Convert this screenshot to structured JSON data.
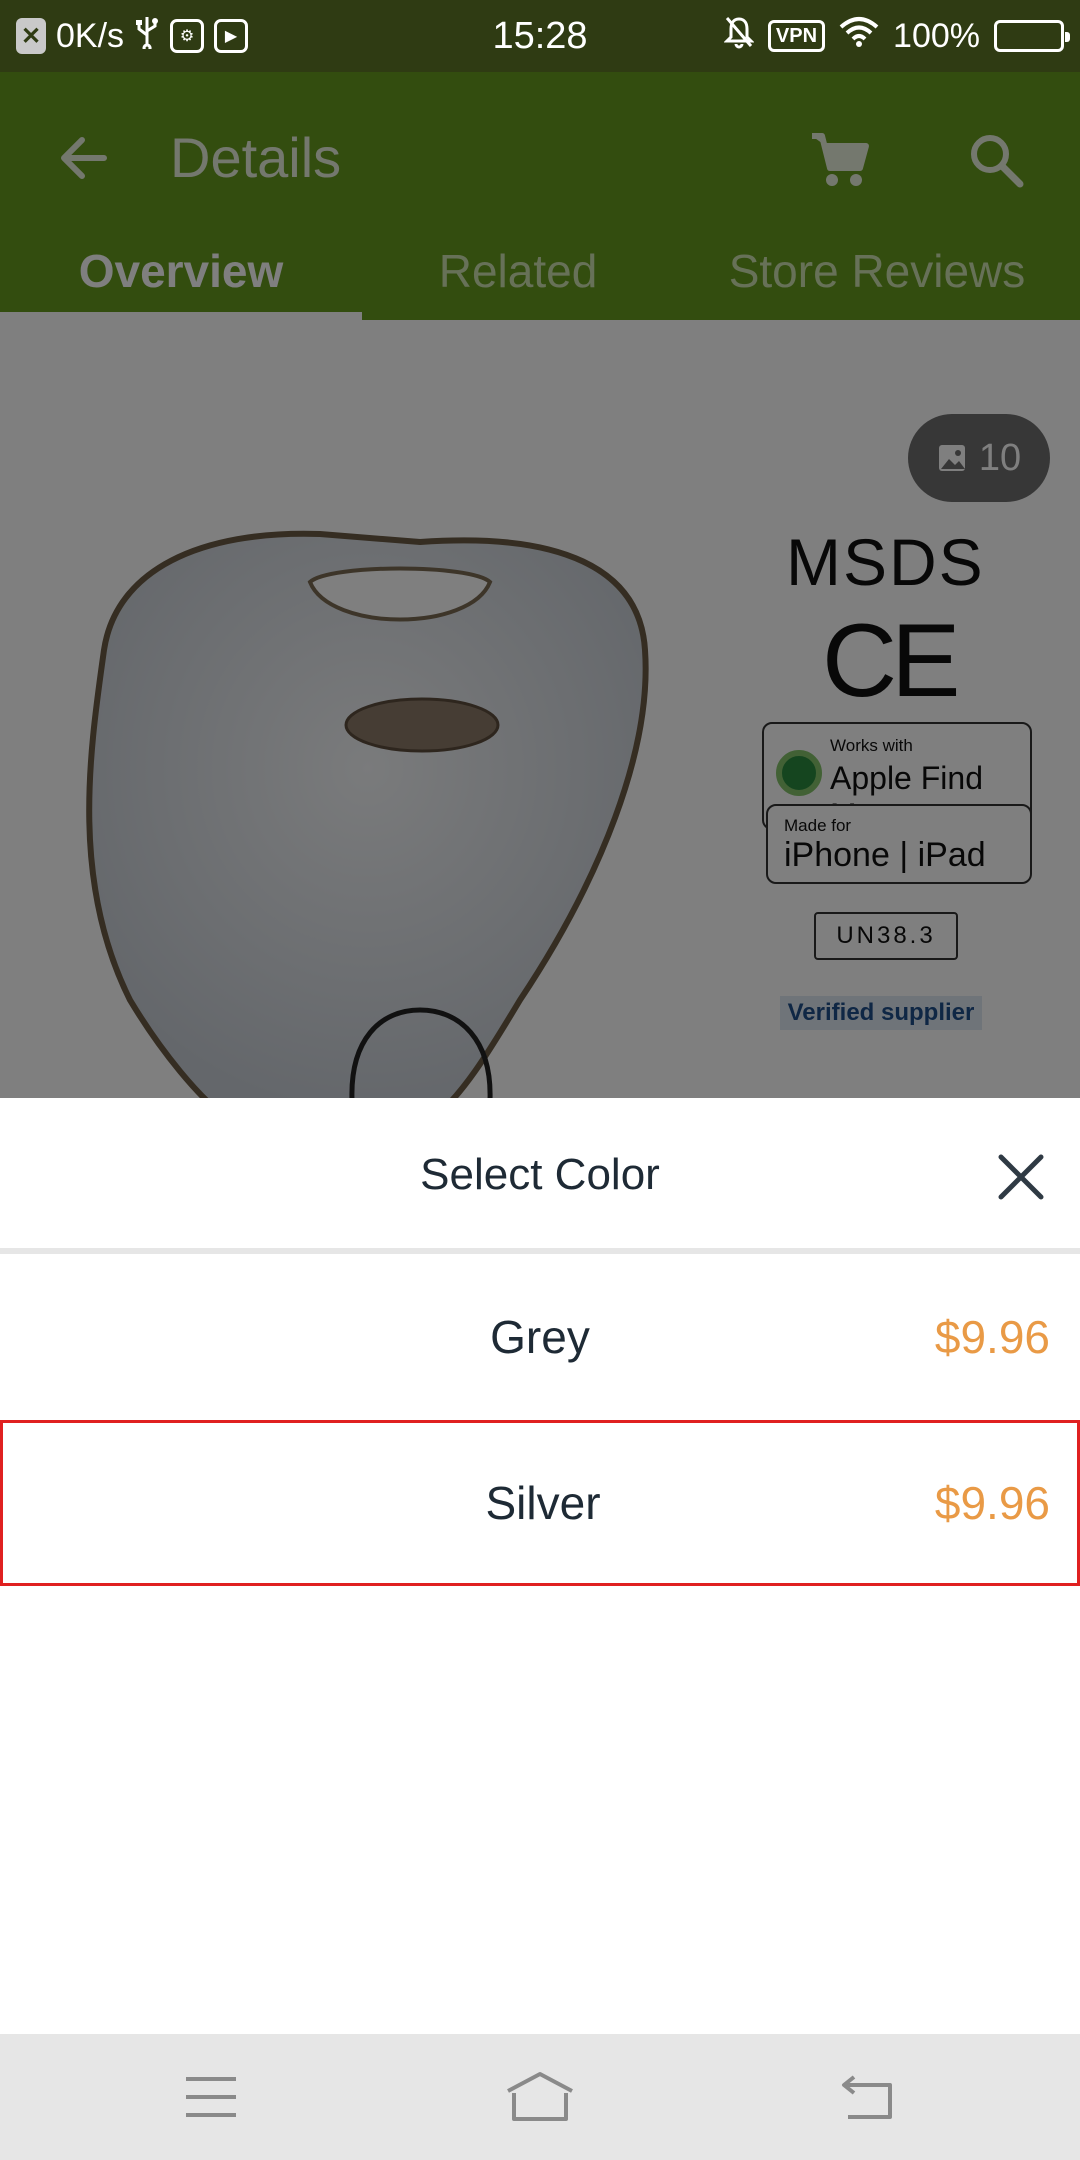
{
  "status_bar": {
    "speed": "0K/s",
    "time": "15:28",
    "vpn": "VPN",
    "battery": "100%",
    "battery_level": 1.0
  },
  "app_bar": {
    "title": "Details",
    "icons": [
      "arrow-back-icon",
      "shopping-cart-icon",
      "search-icon"
    ],
    "color": "#669b1f"
  },
  "tabs": [
    {
      "label": "Overview",
      "active": true
    },
    {
      "label": "Related",
      "active": false
    },
    {
      "label": "Store Reviews",
      "active": false
    }
  ],
  "product": {
    "gallery_count": "10",
    "certifications": {
      "msds": "MSDS",
      "ce": "CE",
      "findmy_small": "Works with",
      "findmy_big": "Apple Find My",
      "mfi_small": "Made for",
      "mfi_big": "iPhone | iPad",
      "un": "UN38.3",
      "verified": "Verified supplier"
    }
  },
  "sheet": {
    "title": "Select Color",
    "options": [
      {
        "name": "Grey",
        "price": "$9.96",
        "selected": false
      },
      {
        "name": "Silver",
        "price": "$9.96",
        "selected": true
      }
    ],
    "price_color": "#e99a46",
    "highlight_color": "#e02020"
  },
  "nav_bar": {
    "icons": [
      "menu-icon",
      "home-icon",
      "back-icon"
    ]
  }
}
